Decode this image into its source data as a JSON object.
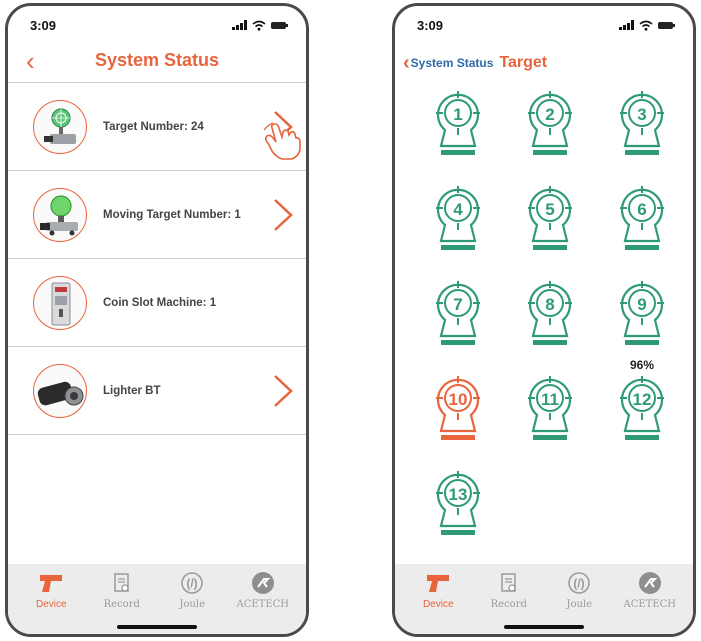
{
  "left_screen": {
    "status_time": "3:09",
    "nav": {
      "back_icon": "chevron-left-icon",
      "title": "System Status"
    },
    "rows": [
      {
        "label": "Target Number:  24",
        "has_chevron": true
      },
      {
        "label": "Moving Target Number: 1",
        "has_chevron": true
      },
      {
        "label": "Coin Slot Machine: 1",
        "has_chevron": false
      },
      {
        "label": "Lighter BT",
        "has_chevron": true
      }
    ]
  },
  "right_screen": {
    "status_time": "3:09",
    "nav": {
      "back_label": "System Status",
      "title": "Target"
    },
    "targets": [
      {
        "number": "1",
        "status": "ok"
      },
      {
        "number": "2",
        "status": "ok"
      },
      {
        "number": "3",
        "status": "ok"
      },
      {
        "number": "4",
        "status": "ok"
      },
      {
        "number": "5",
        "status": "ok"
      },
      {
        "number": "6",
        "status": "ok"
      },
      {
        "number": "7",
        "status": "ok"
      },
      {
        "number": "8",
        "status": "ok"
      },
      {
        "number": "9",
        "status": "ok",
        "battery": "96%"
      },
      {
        "number": "10",
        "status": "alert"
      },
      {
        "number": "11",
        "status": "ok"
      },
      {
        "number": "12",
        "status": "ok"
      },
      {
        "number": "13",
        "status": "ok"
      }
    ]
  },
  "tabbar": {
    "tabs": [
      {
        "label": "Device",
        "icon": "pistol-icon",
        "active": true
      },
      {
        "label": "Record",
        "icon": "clipboard-icon",
        "active": false
      },
      {
        "label": "Joule",
        "icon": "energy-icon",
        "active": false
      },
      {
        "label": "ACETECH",
        "icon": "acetech-logo-icon",
        "active": false
      }
    ]
  },
  "colors": {
    "accent": "#e8643c",
    "target_ok": "#2f9a78",
    "target_alert": "#e8643c",
    "link": "#2d6aa8"
  }
}
